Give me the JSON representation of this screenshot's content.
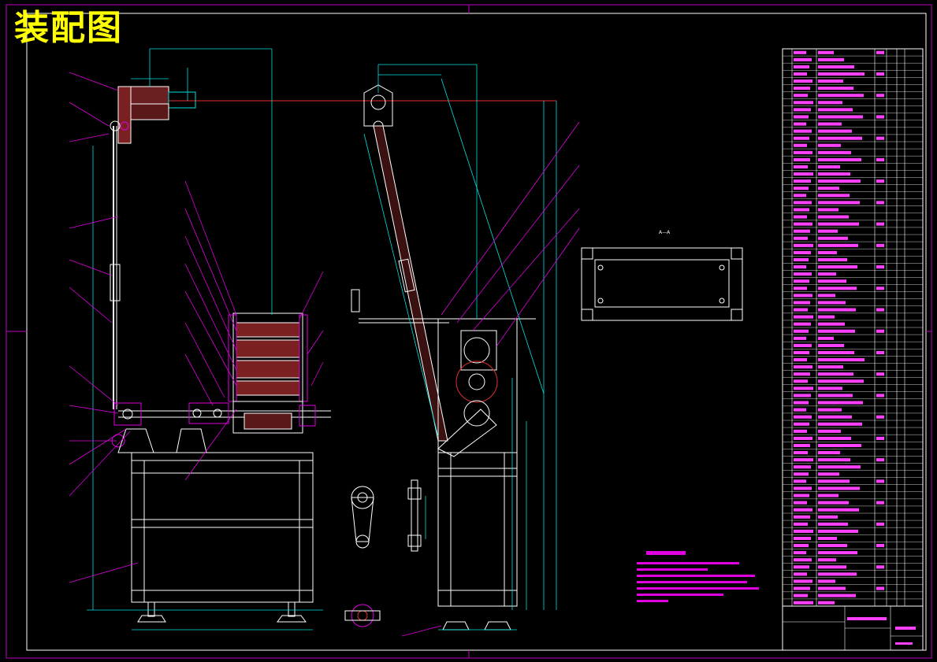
{
  "title": "装配图",
  "colors": {
    "background": "#000000",
    "frame": "#c000c0",
    "title": "#ffff00",
    "outline": "#ffffff",
    "dimension": "#00e0e0",
    "leader": "#e000e0",
    "section": "#e03030",
    "table_text": "#ff40ff"
  },
  "views": [
    "front-view",
    "side-view",
    "section-view",
    "detail-crank",
    "detail-rod",
    "detail-bearing"
  ],
  "parts_table_rows": 78,
  "section_view_label": "A—A"
}
